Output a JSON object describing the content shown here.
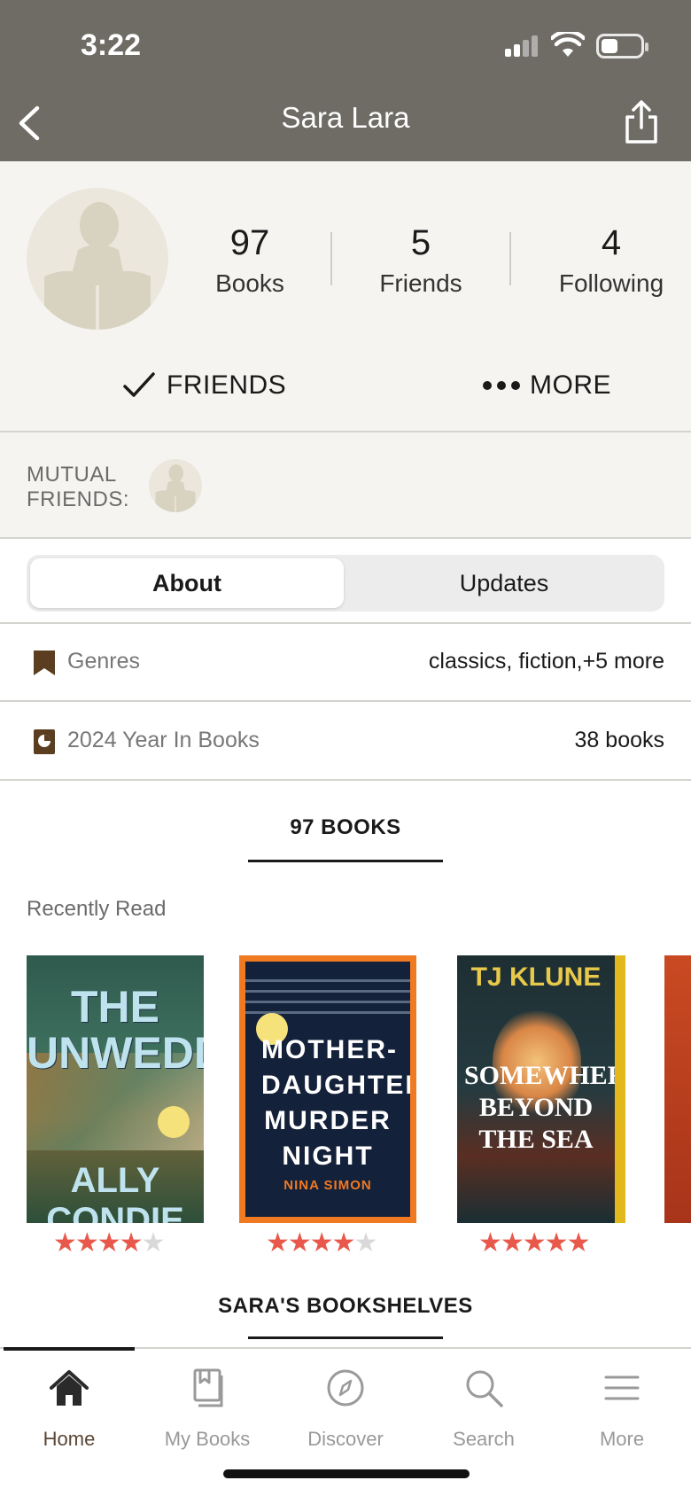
{
  "status_bar": {
    "time": "3:22"
  },
  "nav": {
    "title": "Sara Lara"
  },
  "profile": {
    "stats": [
      {
        "value": "97",
        "label": "Books"
      },
      {
        "value": "5",
        "label": "Friends"
      },
      {
        "value": "4",
        "label": "Following"
      }
    ],
    "friends_label": "FRIENDS",
    "more_label": "MORE"
  },
  "mutual": {
    "label": "MUTUAL FRIENDS:"
  },
  "segment": {
    "about": "About",
    "updates": "Updates"
  },
  "info": {
    "genres": {
      "label": "Genres",
      "value": "classics, fiction,+5 more"
    },
    "year": {
      "label": "2024 Year In Books",
      "value": "38 books"
    }
  },
  "books": {
    "tab_label": "97 BOOKS",
    "recent_label": "Recently Read",
    "items": [
      {
        "cover_title": "THE UNWEDDING",
        "cover_author": "ALLY CONDIE",
        "rating": 4
      },
      {
        "cover_title": "MOTHER-DAUGHTER MURDER NIGHT",
        "cover_author": "NINA SIMON",
        "rating": 4
      },
      {
        "cover_title": "SOMEWHERE BEYOND THE SEA",
        "cover_author": "TJ KLUNE",
        "rating": 5
      }
    ]
  },
  "shelves": {
    "tab_label": "SARA'S BOOKSHELVES"
  },
  "tabbar": {
    "items": [
      {
        "label": "Home",
        "icon": "home-icon"
      },
      {
        "label": "My Books",
        "icon": "my-books-icon"
      },
      {
        "label": "Discover",
        "icon": "compass-icon"
      },
      {
        "label": "Search",
        "icon": "search-icon"
      },
      {
        "label": "More",
        "icon": "menu-icon"
      }
    ]
  },
  "colors": {
    "header": "#6f6c66",
    "star": "#e8584b",
    "panel": "#f5f4f1",
    "icon_brown": "#5b3d1f"
  }
}
